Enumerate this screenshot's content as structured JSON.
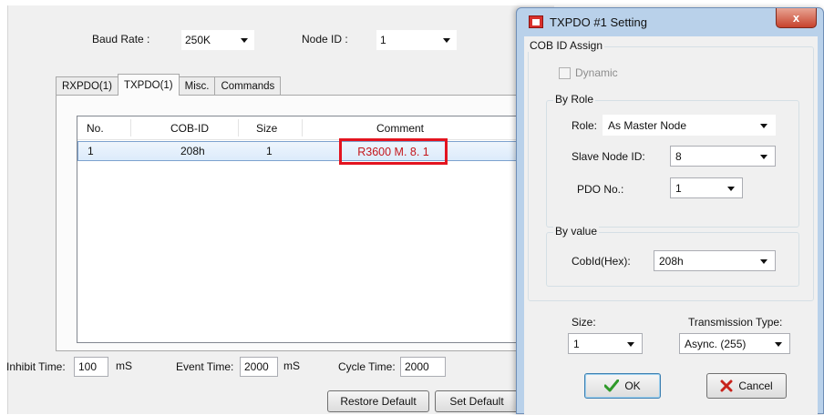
{
  "main": {
    "baud_rate_label": "Baud Rate :",
    "baud_rate_value": "250K",
    "node_id_label": "Node ID :",
    "node_id_value": "1",
    "tabs": [
      {
        "label": "RXPDO(1)"
      },
      {
        "label": "TXPDO(1)"
      },
      {
        "label": "Misc."
      },
      {
        "label": "Commands"
      }
    ],
    "table": {
      "headers": [
        "No.",
        "COB-ID",
        "Size",
        "Comment"
      ],
      "rows": [
        {
          "no": "1",
          "cob_id": "208h",
          "size": "1",
          "comment": "R3600 M. 8. 1"
        }
      ]
    },
    "inhibit_time_label": "Inhibit Time:",
    "inhibit_time_value": "100",
    "inhibit_unit": "mS",
    "event_time_label": "Event Time:",
    "event_time_value": "2000",
    "event_unit": "mS",
    "cycle_time_label": "Cycle Time:",
    "cycle_time_value": "2000",
    "restore_default_label": "Restore Default",
    "set_default_label": "Set Default",
    "highlight_color": "#e3141f"
  },
  "dialog": {
    "title": "TXPDO #1 Setting",
    "close_label": "x",
    "cob_id_assign_label": "COB ID Assign",
    "dynamic_label": "Dynamic",
    "by_role_label": "By Role",
    "role_label": "Role:",
    "role_value": "As Master Node",
    "slave_node_id_label": "Slave Node ID:",
    "slave_node_id_value": "8",
    "pdo_no_label": "PDO No.:",
    "pdo_no_value": "1",
    "by_value_label": "By value",
    "cobid_hex_label": "CobId(Hex):",
    "cobid_hex_value": "208h",
    "size_label": "Size:",
    "size_value": "1",
    "transmission_type_label": "Transmission Type:",
    "transmission_type_value": "Async. (255)",
    "ok_label": "OK",
    "cancel_label": "Cancel",
    "title_bar_color": "#b9d1ea",
    "close_button_color": "#c7432d"
  }
}
